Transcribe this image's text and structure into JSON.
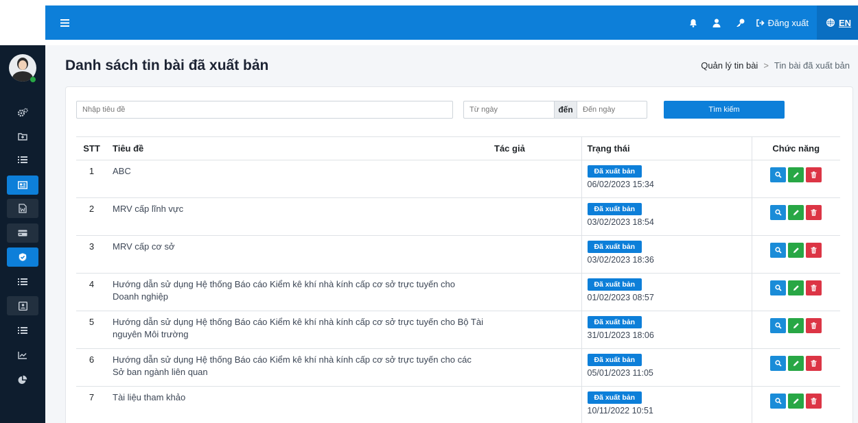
{
  "header": {
    "menu_icon": "hamburger-icon",
    "logout_label": "Đăng xuất",
    "language_label": "EN",
    "icons": [
      "bell-icon",
      "user-icon",
      "key-icon",
      "logout-icon",
      "globe-icon"
    ]
  },
  "sidebar": {
    "items": [
      {
        "icon": "cogs-icon"
      },
      {
        "icon": "folder-plus-icon"
      },
      {
        "icon": "list-icon"
      },
      {
        "icon": "newspaper-icon",
        "active": true
      },
      {
        "icon": "word-file-icon"
      },
      {
        "icon": "card-icon"
      },
      {
        "icon": "shield-check-icon",
        "active": true
      },
      {
        "icon": "list-icon"
      },
      {
        "icon": "contact-icon"
      },
      {
        "icon": "list-icon"
      },
      {
        "icon": "chart-line-icon"
      },
      {
        "icon": "pie-chart-icon"
      }
    ]
  },
  "page": {
    "title": "Danh sách tin bài đã xuất bản",
    "breadcrumb": [
      "Quản lý tin bài",
      "Tin bài đã xuất bản"
    ],
    "breadcrumb_separator": ">"
  },
  "search": {
    "title_placeholder": "Nhập tiêu đề",
    "from_placeholder": "Từ ngày",
    "to_label": "đến",
    "to_placeholder": "Đến ngày",
    "button_label": "Tìm kiếm"
  },
  "table": {
    "headers": {
      "stt": "STT",
      "title": "Tiêu đề",
      "author": "Tác giả",
      "status": "Trạng thái",
      "actions": "Chức năng"
    },
    "rows": [
      {
        "stt": "1",
        "title": "ABC",
        "author": "",
        "status": "Đã xuất bản",
        "date": "06/02/2023 15:34"
      },
      {
        "stt": "2",
        "title": "MRV cấp lĩnh vực",
        "author": "",
        "status": "Đã xuất bản",
        "date": "03/02/2023 18:54"
      },
      {
        "stt": "3",
        "title": "MRV cấp cơ sở",
        "author": "",
        "status": "Đã xuất bản",
        "date": "03/02/2023 18:36"
      },
      {
        "stt": "4",
        "title": "Hướng dẫn sử dụng Hệ thống Báo cáo Kiểm kê khí nhà kính cấp cơ sở trực tuyến cho Doanh nghiệp",
        "author": "",
        "status": "Đã xuất bản",
        "date": "01/02/2023 08:57"
      },
      {
        "stt": "5",
        "title": "Hướng dẫn sử dụng Hệ thống Báo cáo Kiểm kê khí nhà kính cấp cơ sở trực tuyến cho Bộ Tài nguyên Môi trường",
        "author": "",
        "status": "Đã xuất bản",
        "date": "31/01/2023 18:06"
      },
      {
        "stt": "6",
        "title": "Hướng dẫn sử dụng Hệ thống Báo cáo Kiểm kê khí nhà kính cấp cơ sở trực tuyến cho các Sở ban ngành liên quan",
        "author": "",
        "status": "Đã xuất bản",
        "date": "05/01/2023 11:05"
      },
      {
        "stt": "7",
        "title": "Tài liệu tham khảo",
        "author": "",
        "status": "Đã xuất bản",
        "date": "10/11/2022 10:51"
      }
    ]
  },
  "colors": {
    "primary": "#0d7fd9",
    "sidebar": "#0e1d2e",
    "success": "#28a745",
    "danger": "#dc3545"
  }
}
